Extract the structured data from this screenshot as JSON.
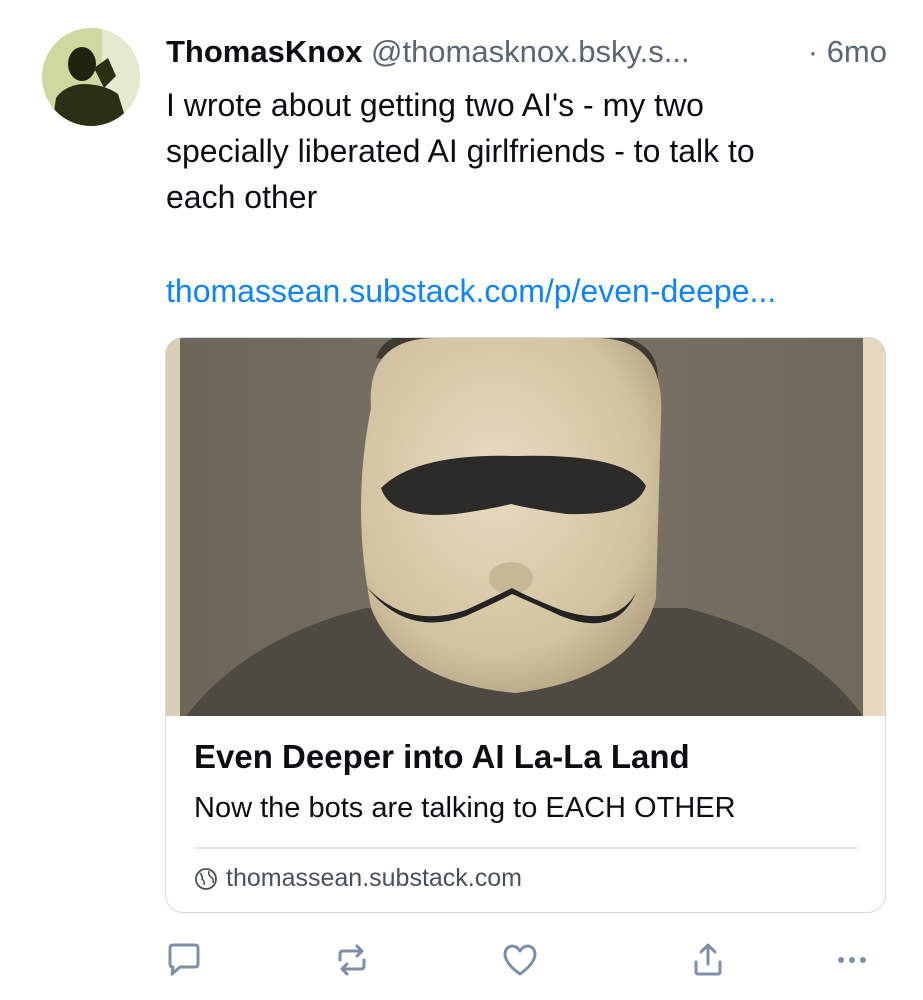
{
  "post": {
    "author": "ThomasKnox",
    "handle": "@thomasknox.bsky.s...",
    "separator": "·",
    "time": "6mo",
    "text_lines": [
      "I wrote about getting two AI's - my two",
      "specially liberated AI girlfriends - to talk to",
      "each other"
    ],
    "link": "thomassean.substack.com/p/even-deepe..."
  },
  "card": {
    "title": "Even Deeper into AI La-La Land",
    "description": "Now the bots are talking to EACH OTHER",
    "domain": "thomassean.substack.com"
  },
  "icons": {
    "avatar": "avatar-silhouette",
    "globe": "globe-icon",
    "reply": "reply-icon",
    "repost": "repost-icon",
    "like": "heart-icon",
    "share": "share-icon",
    "more": "more-icon"
  },
  "colors": {
    "link": "#1083fe",
    "muted": "#5b6673",
    "icon": "#7d8fa8"
  }
}
